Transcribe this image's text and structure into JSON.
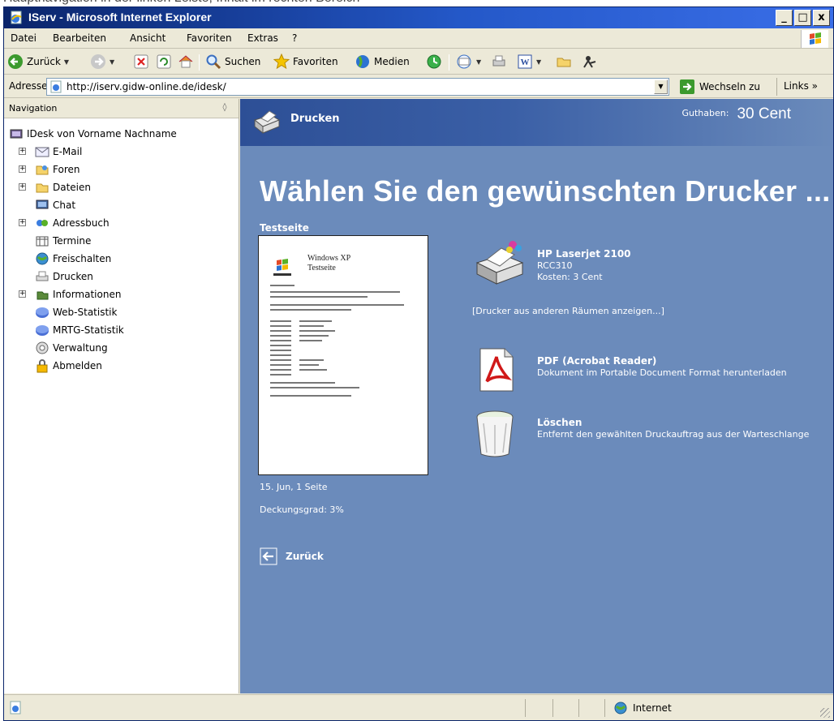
{
  "colors": {
    "title_bar": "#0a246a",
    "content_bg": "#6b8bbb",
    "header_band": "#2d4f96",
    "chrome": "#ece9d8"
  },
  "window": {
    "title": "IServ - Microsoft Internet Explorer",
    "controls": [
      "_",
      "□",
      "x"
    ]
  },
  "menu": {
    "items": [
      "Datei",
      "Bearbeiten",
      "Ansicht",
      "Favoriten",
      "Extras",
      "?"
    ]
  },
  "toolbar": {
    "back": "Zurück",
    "search": "Suchen",
    "favorites": "Favoriten",
    "media": "Medien"
  },
  "address": {
    "label": "Adresse",
    "url": "http://iserv.gidw-online.de/idesk/",
    "go": "Wechseln zu",
    "links": "Links"
  },
  "nav": {
    "header": "Navigation",
    "root": "IDesk von Vorname Nachname",
    "items": [
      {
        "label": "E-Mail",
        "icon": "mail-icon",
        "expandable": true
      },
      {
        "label": "Foren",
        "icon": "forum-icon",
        "expandable": true
      },
      {
        "label": "Dateien",
        "icon": "folder-icon",
        "expandable": true
      },
      {
        "label": "Chat",
        "icon": "chat-icon",
        "expandable": false
      },
      {
        "label": "Adressbuch",
        "icon": "addressbook-icon",
        "expandable": true
      },
      {
        "label": "Termine",
        "icon": "calendar-icon",
        "expandable": false
      },
      {
        "label": "Freischalten",
        "icon": "globe-icon",
        "expandable": false
      },
      {
        "label": "Drucken",
        "icon": "printer-icon",
        "expandable": false
      },
      {
        "label": "Informationen",
        "icon": "info-icon",
        "expandable": true
      },
      {
        "label": "Web-Statistik",
        "icon": "statistics-icon",
        "expandable": false
      },
      {
        "label": "MRTG-Statistik",
        "icon": "statistics-icon",
        "expandable": false
      },
      {
        "label": "Verwaltung",
        "icon": "gear-icon",
        "expandable": false
      },
      {
        "label": "Abmelden",
        "icon": "lock-icon",
        "expandable": false
      }
    ]
  },
  "content": {
    "header_title": "Drucken",
    "credit_label": "Guthaben:",
    "credit_value": "30 Cent",
    "headline": "Wählen Sie den gewünschten Drucker ...",
    "test_page": {
      "title": "Testseite",
      "doc_title_line1": "Windows XP",
      "doc_title_line2": "Testseite",
      "date_pages": "15. Jun, 1 Seite",
      "coverage": "Deckungsgrad: 3%"
    },
    "printer": {
      "name": "HP Laserjet 2100",
      "room": "RCC310",
      "cost": "Kosten: 3 Cent"
    },
    "other_rooms_link": "[Drucker aus anderen Räumen anzeigen...]",
    "actions": [
      {
        "name": "PDF (Acrobat Reader)",
        "desc": "Dokument im Portable Document Format herunterladen",
        "icon": "pdf-icon"
      },
      {
        "name": "Löschen",
        "desc": "Entfernt den gewählten Druckauftrag aus der Warteschlange",
        "icon": "trash-icon"
      }
    ],
    "back_label": "Zurück"
  },
  "status": {
    "zone": "Internet"
  }
}
